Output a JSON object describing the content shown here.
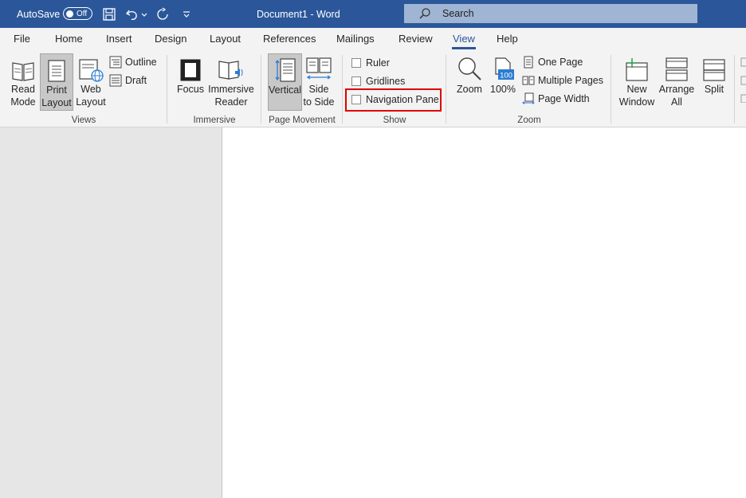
{
  "titlebar": {
    "autosave_label": "AutoSave",
    "autosave_state": "Off",
    "doc_title": "Document1 - Word",
    "search_label": "Search"
  },
  "tabs": [
    {
      "label": "File"
    },
    {
      "label": "Home"
    },
    {
      "label": "Insert"
    },
    {
      "label": "Design"
    },
    {
      "label": "Layout"
    },
    {
      "label": "References"
    },
    {
      "label": "Mailings"
    },
    {
      "label": "Review"
    },
    {
      "label": "View",
      "active": true
    },
    {
      "label": "Help"
    }
  ],
  "ribbon": {
    "views": {
      "label": "Views",
      "read_mode": [
        "Read",
        "Mode"
      ],
      "print_layout": [
        "Print",
        "Layout"
      ],
      "web_layout": [
        "Web",
        "Layout"
      ],
      "outline": "Outline",
      "draft": "Draft"
    },
    "immersive": {
      "label": "Immersive",
      "focus": "Focus",
      "immersive_reader": [
        "Immersive",
        "Reader"
      ]
    },
    "page_movement": {
      "label": "Page Movement",
      "vertical": "Vertical",
      "side_to_side": [
        "Side",
        "to Side"
      ]
    },
    "show": {
      "label": "Show",
      "ruler": "Ruler",
      "gridlines": "Gridlines",
      "navigation_pane": "Navigation Pane"
    },
    "zoom": {
      "label": "Zoom",
      "zoom": "Zoom",
      "zoom_100": "100%",
      "zoom_100_badge": "100",
      "one_page": "One Page",
      "multiple_pages": "Multiple Pages",
      "page_width": "Page Width"
    },
    "window": {
      "new_window": [
        "New",
        "Window"
      ],
      "arrange_all": [
        "Arrange",
        "All"
      ],
      "split": "Split"
    }
  },
  "colors": {
    "accent": "#2b579a",
    "highlight": "#e00000"
  }
}
